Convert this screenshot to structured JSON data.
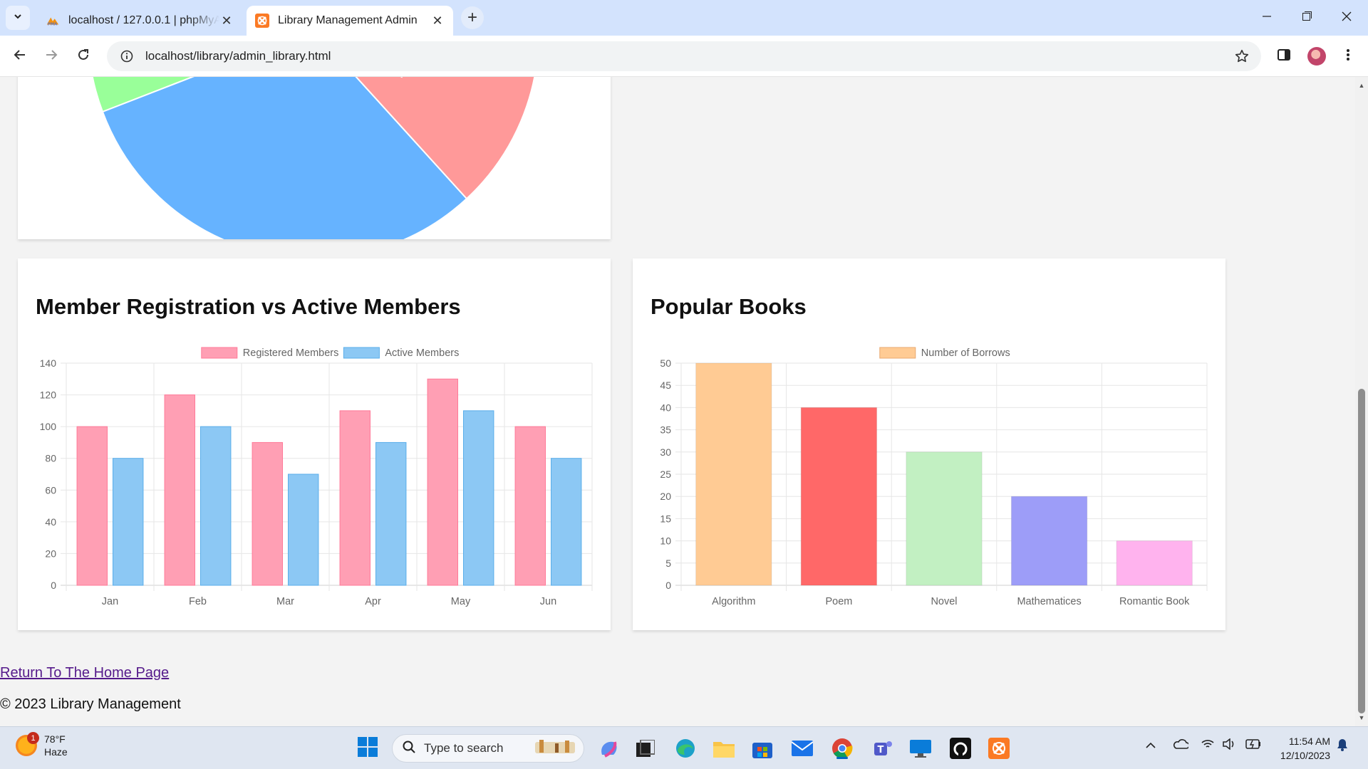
{
  "browser": {
    "tabs": [
      {
        "title": "localhost / 127.0.0.1 | phpMyAdmin",
        "active": false,
        "icon": "phpmyadmin-icon"
      },
      {
        "title": "Library Management Admin",
        "active": true,
        "icon": "xampp-icon"
      }
    ],
    "url": "localhost/library/admin_library.html"
  },
  "page": {
    "pie_colors": [
      "#99ff99",
      "#66b3ff",
      "#ff9999"
    ],
    "members_chart": {
      "title": "Member Registration vs Active Members"
    },
    "books_chart": {
      "title": "Popular Books"
    },
    "home_link": "Return To The Home Page",
    "copyright": "© 2023 Library Management"
  },
  "chart_data": [
    {
      "type": "bar",
      "title": "Member Registration vs Active Members",
      "categories": [
        "Jan",
        "Feb",
        "Mar",
        "Apr",
        "May",
        "Jun"
      ],
      "series": [
        {
          "name": "Registered Members",
          "values": [
            100,
            120,
            90,
            110,
            130,
            100
          ],
          "color": "#ff9fb4",
          "border": "#ff7a98"
        },
        {
          "name": "Active Members",
          "values": [
            80,
            100,
            70,
            90,
            110,
            80
          ],
          "color": "#8cc8f4",
          "border": "#5aaeea"
        }
      ],
      "ylim": [
        0,
        140
      ],
      "yticks": [
        0,
        20,
        40,
        60,
        80,
        100,
        120,
        140
      ],
      "grid": true,
      "legend": "top"
    },
    {
      "type": "bar",
      "title": "Popular Books",
      "categories": [
        "Algorithm",
        "Poem",
        "Novel",
        "Mathematices",
        "Romantic Book"
      ],
      "series": [
        {
          "name": "Number of Borrows",
          "values": [
            50,
            40,
            30,
            20,
            10
          ]
        }
      ],
      "colors": [
        "#ffcb94",
        "#ff6868",
        "#c2f0c2",
        "#9d9df8",
        "#ffb3ee"
      ],
      "legend_color": "#ffcb94",
      "ylim": [
        0,
        50
      ],
      "yticks": [
        0,
        5,
        10,
        15,
        20,
        25,
        30,
        35,
        40,
        45,
        50
      ],
      "grid": true,
      "legend": "top"
    }
  ],
  "taskbar": {
    "weather": {
      "temp": "78°F",
      "condition": "Haze",
      "badge": "1"
    },
    "search_placeholder": "Type to search",
    "time": "11:54 AM",
    "date": "12/10/2023"
  }
}
